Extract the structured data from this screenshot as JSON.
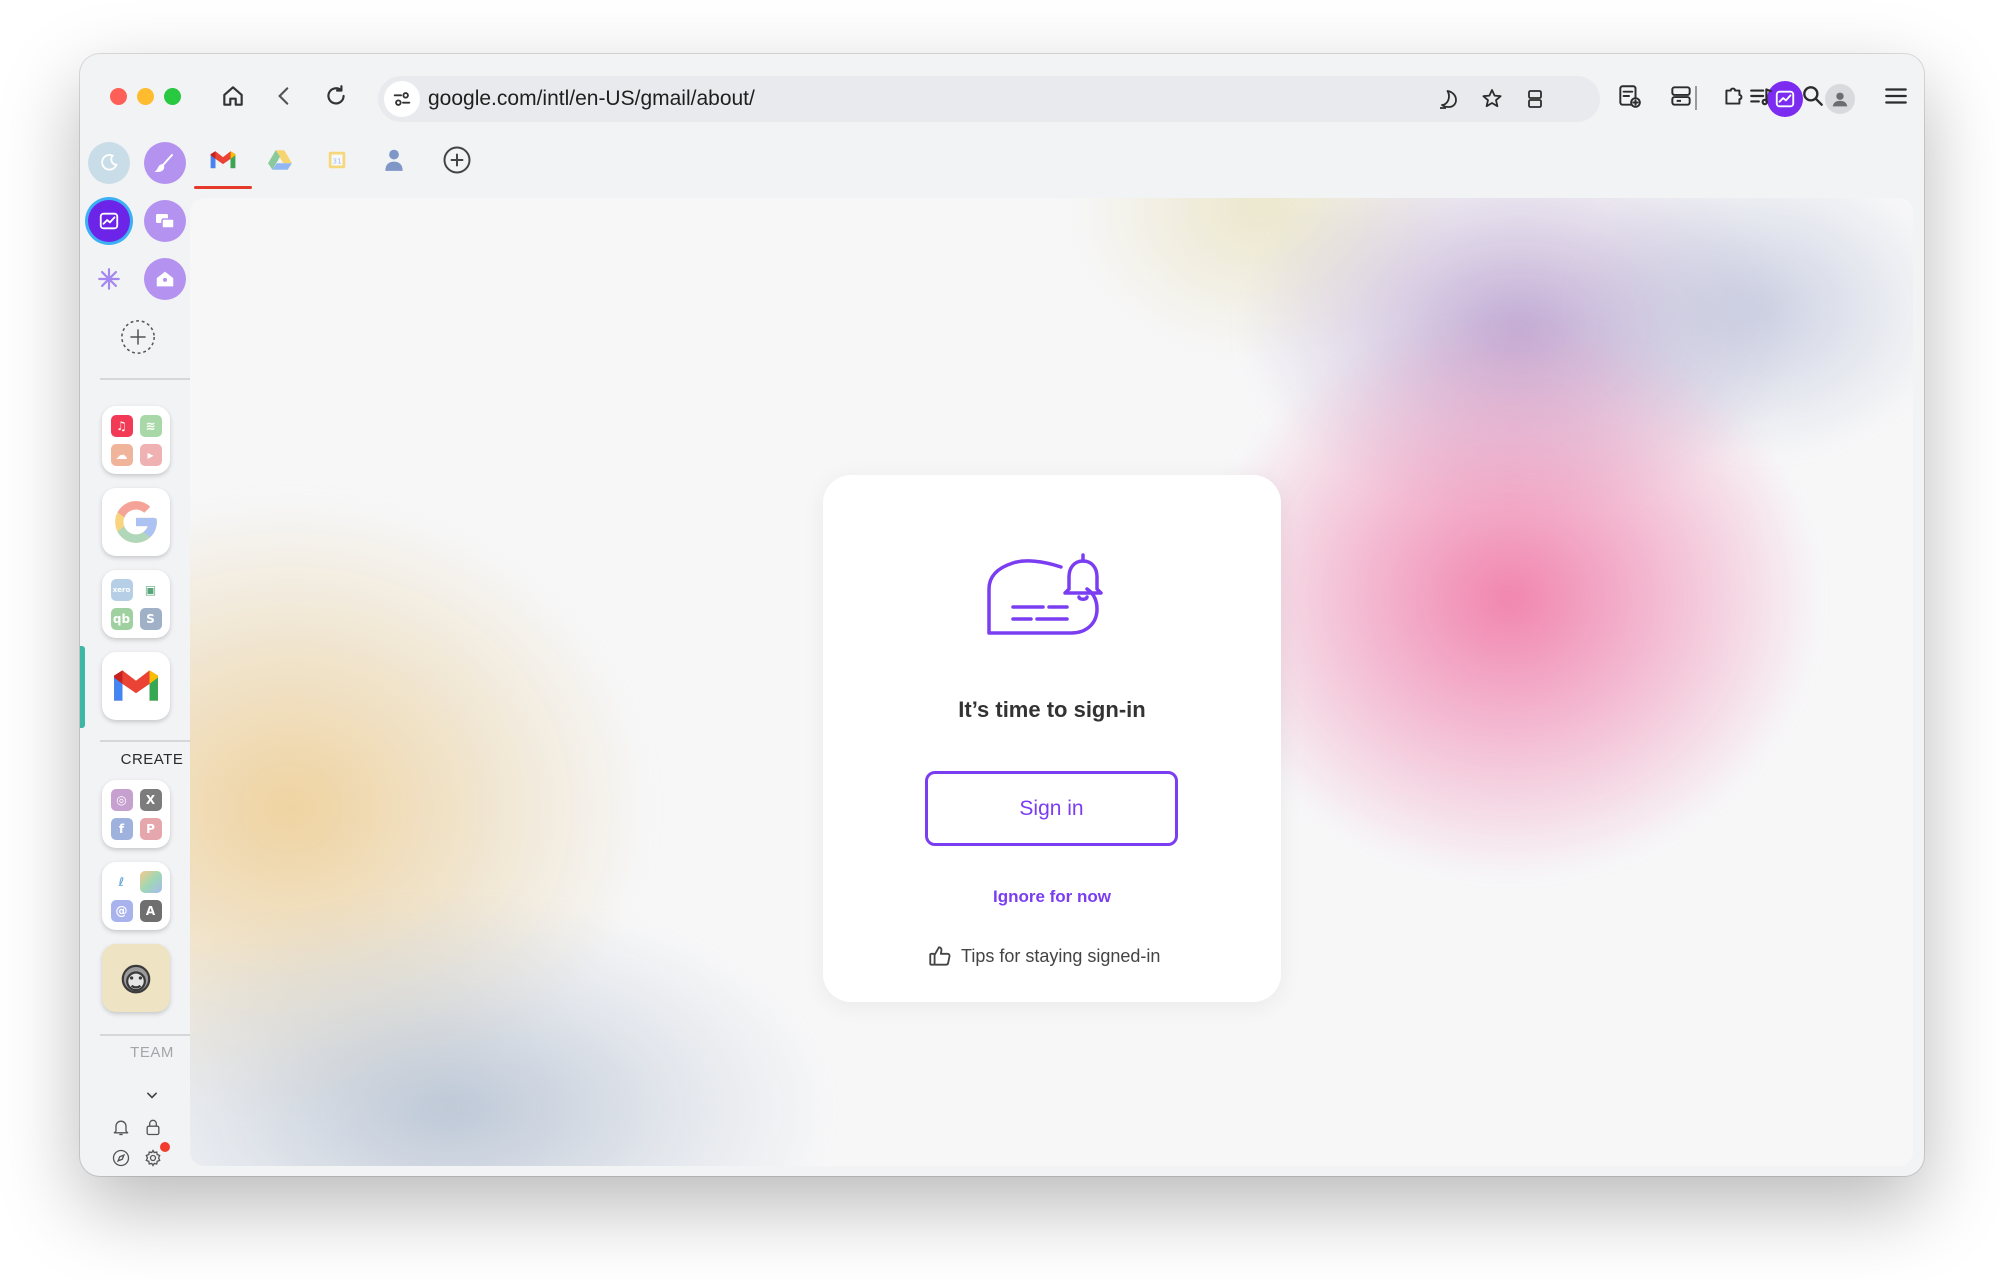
{
  "browser": {
    "url": "google.com/intl/en-US/gmail/about/",
    "toolbar_icons": [
      "home-icon",
      "back-icon",
      "reload-icon",
      "site-settings-icon",
      "dark-mode-icon",
      "bookmark-star-icon",
      "tab-layout-icon",
      "analytics-extension-icon",
      "reading-list-icon",
      "split-view-icon",
      "extensions-icon",
      "media-control-icon",
      "search-icon",
      "profile-icon",
      "menu-icon"
    ]
  },
  "tabs": [
    "gmail-tab",
    "google-drive-tab",
    "google-calendar-tab",
    "contacts-tab",
    "new-tab-button"
  ],
  "sidebar": {
    "create_label": "CREATE",
    "team_label": "TEAM",
    "accent_color": "#3fb7a5",
    "apps": [
      "pinned-app-1",
      "brush-app",
      "analytics-app",
      "mail-app",
      "spark-app",
      "home-app",
      "music-group",
      "google-app",
      "business-group",
      "gmail-app",
      "social-group",
      "design-group",
      "mailchimp-app"
    ]
  },
  "card": {
    "title": "It’s time to sign-in",
    "sign_in_label": "Sign in",
    "ignore_label": "Ignore for now",
    "tips_label": "Tips for staying signed-in",
    "accent_color": "#7b3df2"
  }
}
